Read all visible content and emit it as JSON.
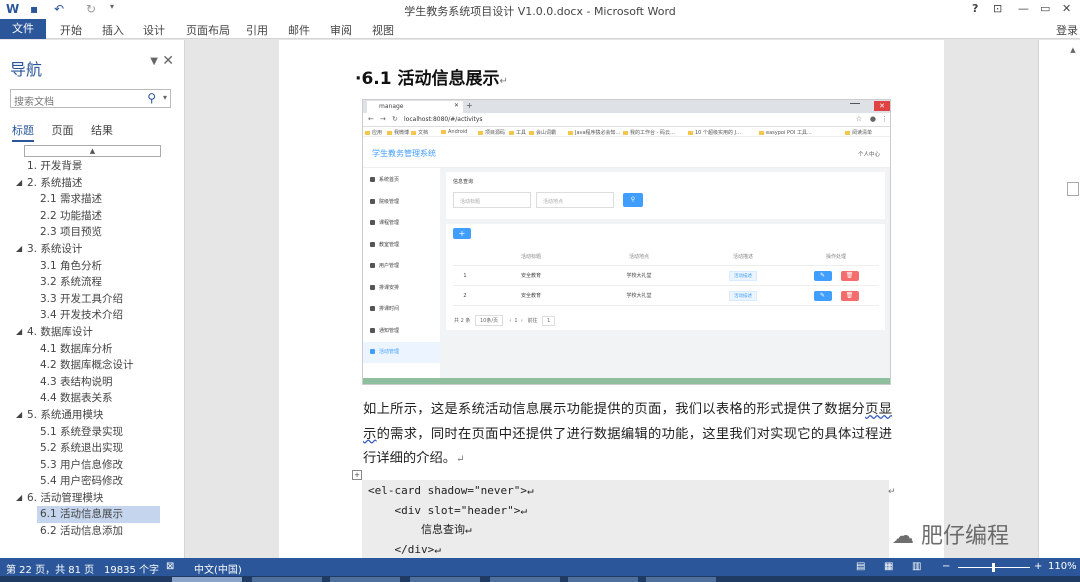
{
  "window": {
    "title": "学生教务系统项目设计 V1.0.0.docx - Microsoft Word",
    "help": "?",
    "minimize": "—",
    "restore": "▭",
    "close": "✕"
  },
  "ribbon": {
    "tabs": [
      "文件",
      "开始",
      "插入",
      "设计",
      "页面布局",
      "引用",
      "邮件",
      "审阅",
      "视图"
    ],
    "login": "登录"
  },
  "nav_pane": {
    "title": "导航",
    "search_placeholder": "搜索文档",
    "tabs": [
      "标题",
      "页面",
      "结果"
    ],
    "items": [
      {
        "level": 1,
        "label": "1. 开发背景",
        "expand": ""
      },
      {
        "level": 1,
        "label": "2. 系统描述",
        "expand": "◢"
      },
      {
        "level": 2,
        "label": "2.1 需求描述"
      },
      {
        "level": 2,
        "label": "2.2 功能描述"
      },
      {
        "level": 2,
        "label": "2.3 项目预览"
      },
      {
        "level": 1,
        "label": "3. 系统设计",
        "expand": "◢"
      },
      {
        "level": 2,
        "label": "3.1 角色分析"
      },
      {
        "level": 2,
        "label": "3.2 系统流程"
      },
      {
        "level": 2,
        "label": "3.3 开发工具介绍"
      },
      {
        "level": 2,
        "label": "3.4 开发技术介绍"
      },
      {
        "level": 1,
        "label": "4. 数据库设计",
        "expand": "◢"
      },
      {
        "level": 2,
        "label": "4.1 数据库分析"
      },
      {
        "level": 2,
        "label": "4.2 数据库概念设计"
      },
      {
        "level": 2,
        "label": "4.3 表结构说明"
      },
      {
        "level": 2,
        "label": "4.4 数据表关系"
      },
      {
        "level": 1,
        "label": "5. 系统通用模块",
        "expand": "◢"
      },
      {
        "level": 2,
        "label": "5.1 系统登录实现"
      },
      {
        "level": 2,
        "label": "5.2 系统退出实现"
      },
      {
        "level": 2,
        "label": "5.3 用户信息修改"
      },
      {
        "level": 2,
        "label": "5.4 用户密码修改"
      },
      {
        "level": 1,
        "label": "6. 活动管理模块",
        "expand": "◢"
      },
      {
        "level": 2,
        "label": "6.1 活动信息展示",
        "selected": true
      },
      {
        "level": 2,
        "label": "6.2 活动信息添加"
      }
    ]
  },
  "doc": {
    "heading": "·6.1  活动信息展示",
    "paragraph_a": "如上所示，这是系统活动信息展示功能提供的页面，我们以表格的形式提供了数据分",
    "paragraph_u": "页显示",
    "paragraph_b": "的需求，同时在页面中还提供了进行数据编辑的功能，这里我们对实现它的具体过程进行详细的介绍。",
    "return_mark": "↵",
    "code_lines": [
      "<el-card shadow=\"never\">↵",
      "    <div slot=\"header\">↵",
      "        信息查询↵",
      "    </div>↵"
    ]
  },
  "screenshot": {
    "tab_title": "manage",
    "url": "localhost:8080/#/activitys",
    "bookmarks": [
      "应用",
      "我微博",
      "文档",
      "Android",
      "项目源码",
      "工具",
      "会山词霸",
      "Java程序猿必会知…",
      "我的工作台 - 码云…",
      "10 个超级实用的 J…",
      "easypoi POI 工具…",
      "阅读清单"
    ],
    "app_title": "学生教务管理系统",
    "app_user": "个人中心",
    "menu": [
      "系统首页",
      "院级管理",
      "课程管理",
      "教室管理",
      "用户管理",
      "排课安排",
      "排课时间",
      "通知管理",
      "活动管理"
    ],
    "query_title": "信息查询",
    "input1": "活动标题",
    "input2": "活动地点",
    "columns": [
      "",
      "活动标题",
      "活动地点",
      "活动描述",
      "操作处理"
    ],
    "rows": [
      {
        "no": "1",
        "title": "安全教育",
        "place": "学校大礼堂",
        "desc": "活动描述"
      },
      {
        "no": "2",
        "title": "安全教育",
        "place": "学校大礼堂",
        "desc": "活动描述"
      }
    ],
    "pager": {
      "total": "共 2 条",
      "size": "10条/页",
      "page": "1",
      "goto": "前往",
      "goto_page": "1",
      "unit": "页"
    }
  },
  "watermark": "肥仔编程",
  "status": {
    "page": "第 22 页，共 81 页",
    "words": "19835 个字",
    "lang": "中文(中国)",
    "zoom": "110%"
  },
  "colors": {
    "word_blue": "#2b579a",
    "element_blue": "#409eff",
    "element_red": "#f56c6c"
  }
}
